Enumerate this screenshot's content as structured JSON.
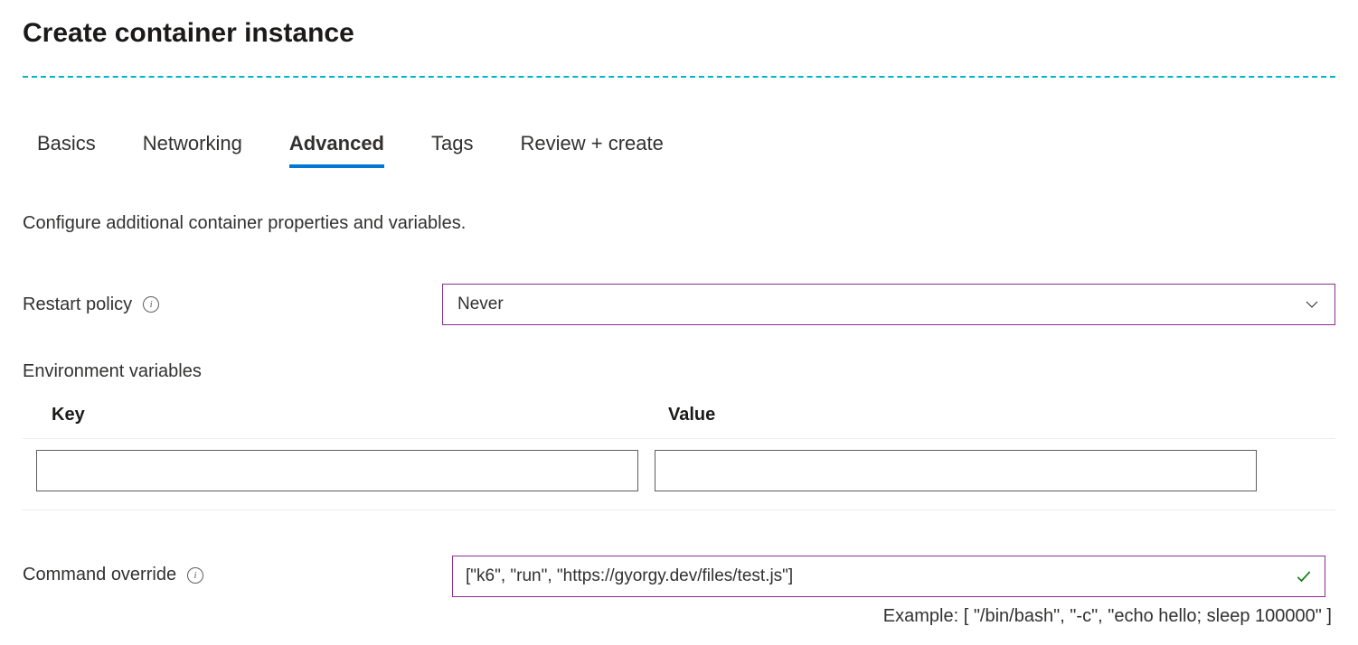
{
  "page": {
    "title": "Create container instance"
  },
  "tabs": [
    {
      "label": "Basics",
      "active": false
    },
    {
      "label": "Networking",
      "active": false
    },
    {
      "label": "Advanced",
      "active": true
    },
    {
      "label": "Tags",
      "active": false
    },
    {
      "label": "Review + create",
      "active": false
    }
  ],
  "description": "Configure additional container properties and variables.",
  "restartPolicy": {
    "label": "Restart policy",
    "value": "Never"
  },
  "envVars": {
    "label": "Environment variables",
    "headers": {
      "key": "Key",
      "value": "Value"
    },
    "row": {
      "key": "",
      "value": ""
    }
  },
  "commandOverride": {
    "label": "Command override",
    "value": "[\"k6\", \"run\", \"https://gyorgy.dev/files/test.js\"]",
    "example": "Example: [ \"/bin/bash\", \"-c\", \"echo hello; sleep 100000\" ]"
  },
  "colors": {
    "accent": "#0078d4",
    "inputBorderFocus": "#8c2d91",
    "dashedDivider": "#00b7c3",
    "valid": "#107c10"
  }
}
